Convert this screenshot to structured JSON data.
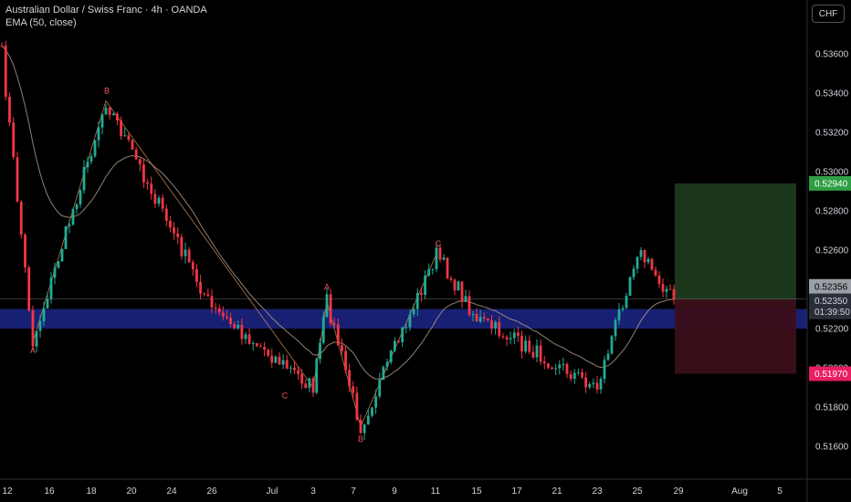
{
  "header": {
    "symbol_title": "Australian Dollar / Swiss Franc · 4h · OANDA",
    "indicator": "EMA (50, close)",
    "currency_button": "CHF"
  },
  "colors": {
    "background": "#000000",
    "up_candle": "#22ab94",
    "down_candle": "#f23645",
    "ema_line": "#b8a089",
    "zone_band": "#1a237e",
    "target_zone": "#1b3a1e",
    "stop_zone": "#3b0f1a",
    "target_label": "#2e9e44",
    "stop_label": "#e91e63",
    "wave_label": "#f77b6b"
  },
  "chart_data": {
    "type": "candlestick",
    "timeframe": "4h",
    "y_axis": {
      "ticks": [
        "0.53600",
        "0.53400",
        "0.53200",
        "0.53000",
        "0.52800",
        "0.52600",
        "0.52200",
        "0.52000",
        "0.51800",
        "0.51600"
      ],
      "range": [
        0.515,
        0.5375
      ]
    },
    "x_axis": {
      "ticks": [
        "12",
        "16",
        "18",
        "20",
        "24",
        "26",
        "Jul",
        "3",
        "7",
        "9",
        "11",
        "15",
        "17",
        "21",
        "23",
        "25",
        "29",
        "Aug",
        "5"
      ]
    },
    "price_labels": {
      "target": "0.52940",
      "current_high": "0.52356",
      "current": "0.52350",
      "countdown": "01:39:50",
      "stop": "0.51970"
    },
    "support_zone": {
      "top": 0.523,
      "bottom": 0.522
    },
    "wave_labels": [
      {
        "text": "A",
        "x": "12",
        "price": 0.5213
      },
      {
        "text": "B",
        "x": "18",
        "price": 0.5338
      },
      {
        "text": "C",
        "x": "3",
        "price": 0.519
      },
      {
        "text": "A",
        "x": "7",
        "price": 0.5238
      },
      {
        "text": "B",
        "x": "7",
        "price": 0.5168
      },
      {
        "text": "C",
        "x": "11",
        "price": 0.526
      }
    ],
    "key_points": [
      {
        "x": "11",
        "price": 0.536
      },
      {
        "x": "12",
        "price": 0.5213
      },
      {
        "x": "18",
        "price": 0.5336
      },
      {
        "x": "26",
        "price": 0.523
      },
      {
        "x": "3",
        "price": 0.519
      },
      {
        "x": "7",
        "price": 0.5234
      },
      {
        "x": "7",
        "price": 0.517
      },
      {
        "x": "11",
        "price": 0.5258
      },
      {
        "x": "15",
        "price": 0.5225
      },
      {
        "x": "23",
        "price": 0.519
      },
      {
        "x": "25",
        "price": 0.526
      },
      {
        "x": "29",
        "price": 0.5235
      }
    ]
  }
}
